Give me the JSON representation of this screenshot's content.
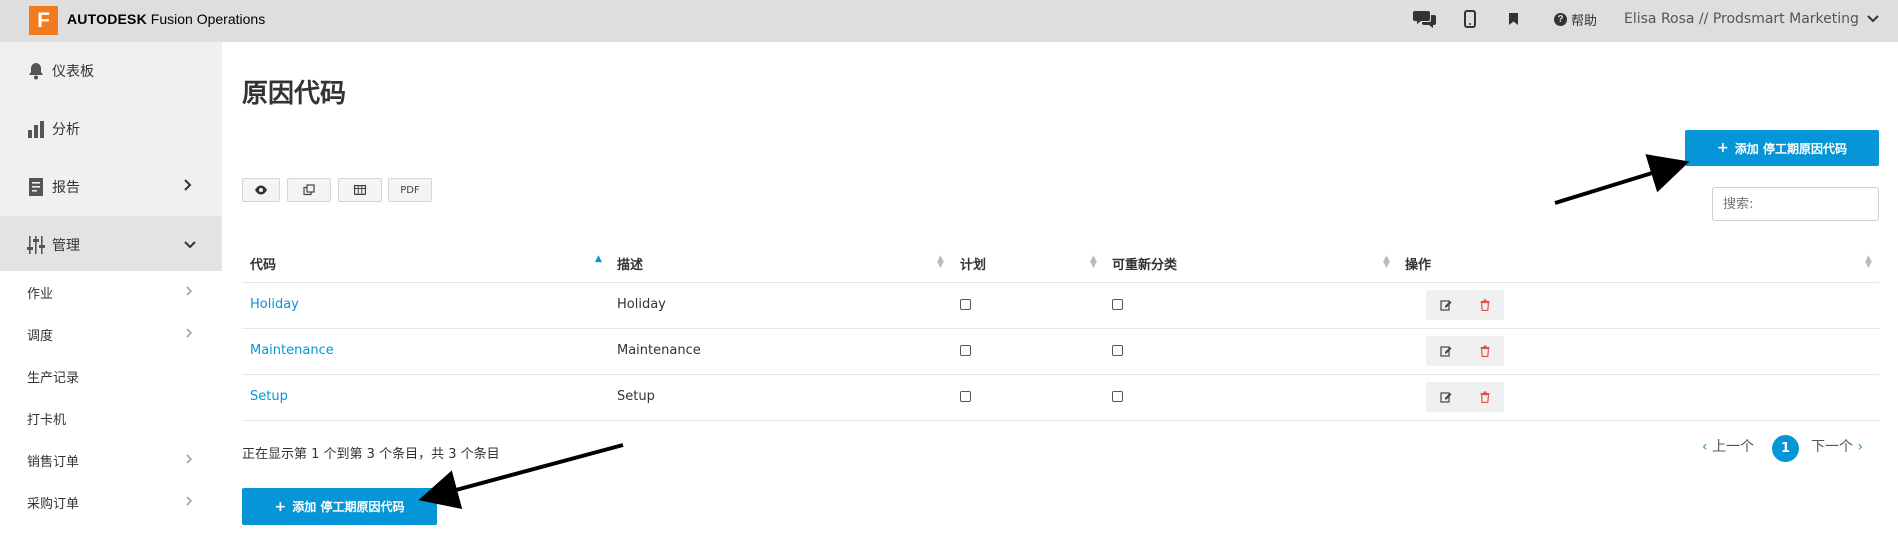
{
  "topbar": {
    "logo_letter": "F",
    "brand_bold": "AUTODESK",
    "brand_rest": "Fusion Operations",
    "help_label": "帮助",
    "help_glyph": "?",
    "user": "Elisa Rosa // Prodsmart Marketing"
  },
  "sidebar": {
    "items": [
      {
        "label": "仪表板",
        "icon": "bell-icon"
      },
      {
        "label": "分析",
        "icon": "bar-chart-icon"
      },
      {
        "label": "报告",
        "icon": "report-icon"
      },
      {
        "label": "管理",
        "icon": "sliders-icon"
      }
    ],
    "subitems": [
      {
        "label": "作业"
      },
      {
        "label": "调度"
      },
      {
        "label": "生产记录"
      },
      {
        "label": "打卡机"
      },
      {
        "label": "销售订单"
      },
      {
        "label": "采购订单"
      }
    ]
  },
  "main": {
    "title": "原因代码",
    "add_button_label": "添加 停工期原因代码",
    "add_button_icon": "+",
    "toolbar": {
      "pdf_label": "PDF"
    },
    "search_placeholder": "搜索:",
    "columns": [
      "代码",
      "描述",
      "计划",
      "可重新分类",
      "操作"
    ],
    "rows": [
      {
        "code": "Holiday",
        "description": "Holiday"
      },
      {
        "code": "Maintenance",
        "description": "Maintenance"
      },
      {
        "code": "Setup",
        "description": "Setup"
      }
    ],
    "info": "正在显示第 1 个到第 3 个条目，共 3 个条目",
    "pagination": {
      "prev": "上一个",
      "page": "1",
      "next": "下一个"
    }
  },
  "colors": {
    "accent": "#0696d7",
    "logo": "#f47a20",
    "topbar": "#dedede",
    "sidebar": "#f0f0f0",
    "delete": "#e0524a"
  }
}
